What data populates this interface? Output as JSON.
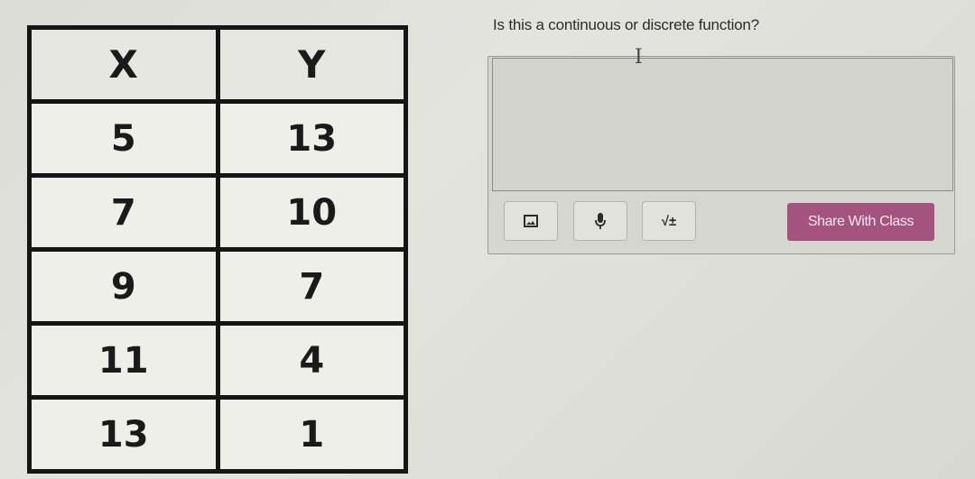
{
  "table": {
    "headers": [
      "X",
      "Y"
    ],
    "rows": [
      [
        "5",
        "13"
      ],
      [
        "7",
        "10"
      ],
      [
        "9",
        "7"
      ],
      [
        "11",
        "4"
      ],
      [
        "13",
        "1"
      ]
    ]
  },
  "question": {
    "text": "Is this a continuous or discrete function?"
  },
  "answer": {
    "value": "",
    "placeholder": ""
  },
  "toolbar": {
    "image_icon": "image-icon",
    "mic_icon": "microphone-icon",
    "math_label": "√±",
    "share_label": "Share With Class"
  },
  "colors": {
    "share_button": "#a4527e"
  }
}
